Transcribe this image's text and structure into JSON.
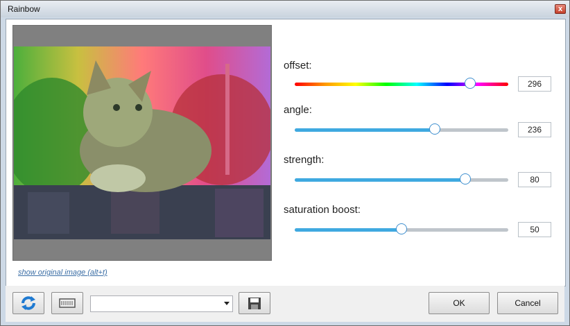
{
  "window": {
    "title": "Rainbow",
    "close_glyph": "x"
  },
  "preview": {
    "show_original_link": "show original image (alt+t)"
  },
  "controls": [
    {
      "label": "offset:",
      "value": "296",
      "position": 0.82,
      "style": "rainbow"
    },
    {
      "label": "angle:",
      "value": "236",
      "position": 0.655,
      "style": "blue"
    },
    {
      "label": "strength:",
      "value": "80",
      "position": 0.8,
      "style": "blue"
    },
    {
      "label": "saturation boost:",
      "value": "50",
      "position": 0.5,
      "style": "blue"
    }
  ],
  "footer": {
    "reset_icon": "refresh-icon",
    "presets_icon": "keyboard-icon",
    "save_icon": "save-icon",
    "preset_selected": "",
    "ok_label": "OK",
    "cancel_label": "Cancel"
  },
  "colors": {
    "accent": "#3fa9e0",
    "track": "#bfc5cb"
  }
}
